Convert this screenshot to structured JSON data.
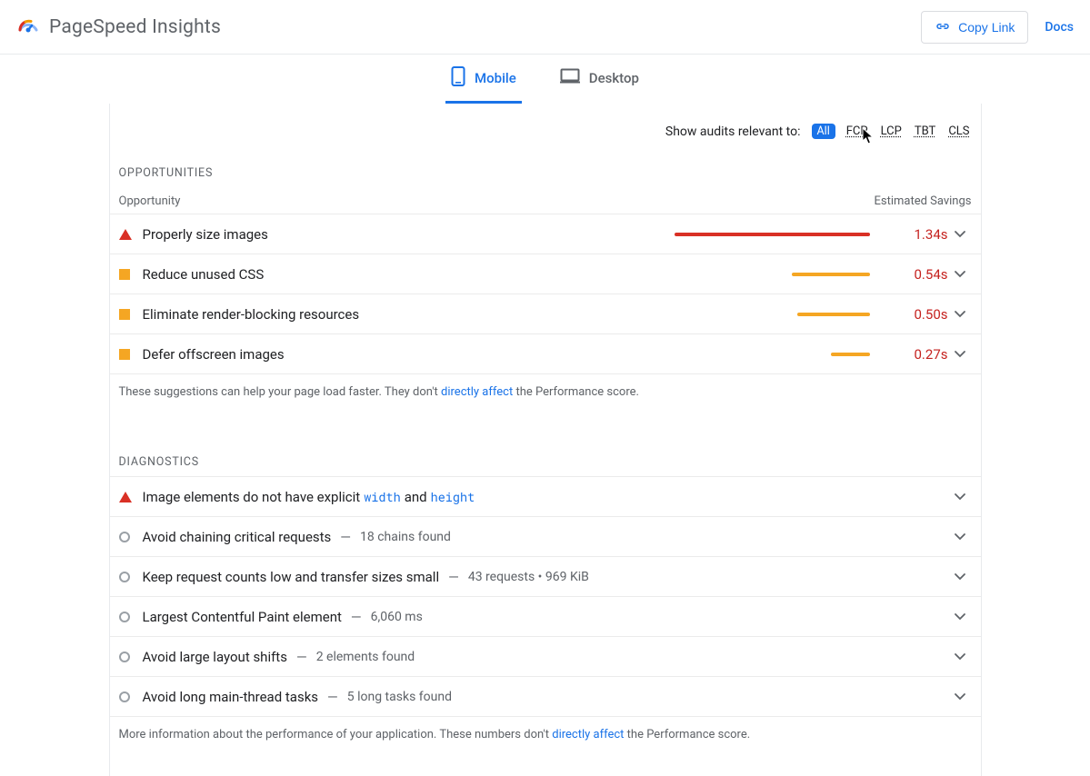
{
  "header": {
    "brand": "PageSpeed Insights",
    "copy_link": "Copy Link",
    "docs": "Docs"
  },
  "tabs": {
    "mobile": "Mobile",
    "desktop": "Desktop",
    "active": "mobile"
  },
  "filter": {
    "label": "Show audits relevant to:",
    "active": "All",
    "chips": {
      "all": "All",
      "fcp": "FCP",
      "lcp": "LCP",
      "tbt": "TBT",
      "cls": "CLS"
    }
  },
  "opportunities": {
    "heading": "OPPORTUNITIES",
    "col_left": "Opportunity",
    "col_right": "Estimated Savings",
    "rows": [
      {
        "icon": "triangle-red",
        "title": "Properly size images",
        "bar_color": "red",
        "bar_width_pct": 100,
        "savings": "1.34s"
      },
      {
        "icon": "square-orange",
        "title": "Reduce unused CSS",
        "bar_color": "orange",
        "bar_width_pct": 40,
        "savings": "0.54s"
      },
      {
        "icon": "square-orange",
        "title": "Eliminate render-blocking resources",
        "bar_color": "orange",
        "bar_width_pct": 37,
        "savings": "0.50s"
      },
      {
        "icon": "square-orange",
        "title": "Defer offscreen images",
        "bar_color": "orange",
        "bar_width_pct": 20,
        "savings": "0.27s"
      }
    ],
    "footnote_pre": "These suggestions can help your page load faster. They don't ",
    "footnote_link": "directly affect",
    "footnote_post": " the Performance score."
  },
  "diagnostics": {
    "heading": "DIAGNOSTICS",
    "rows": [
      {
        "icon": "triangle-red",
        "title_pre": "Image elements do not have explicit ",
        "code1": "width",
        "mid": " and ",
        "code2": "height",
        "sub": ""
      },
      {
        "icon": "circle-gray",
        "title": "Avoid chaining critical requests",
        "sub": "18 chains found"
      },
      {
        "icon": "circle-gray",
        "title": "Keep request counts low and transfer sizes small",
        "sub": "43 requests • 969 KiB"
      },
      {
        "icon": "circle-gray",
        "title": "Largest Contentful Paint element",
        "sub": "6,060 ms"
      },
      {
        "icon": "circle-gray",
        "title": "Avoid large layout shifts",
        "sub": "2 elements found"
      },
      {
        "icon": "circle-gray",
        "title": "Avoid long main-thread tasks",
        "sub": "5 long tasks found"
      }
    ],
    "footnote_pre": "More information about the performance of your application. These numbers don't ",
    "footnote_link": "directly affect",
    "footnote_post": " the Performance score."
  }
}
